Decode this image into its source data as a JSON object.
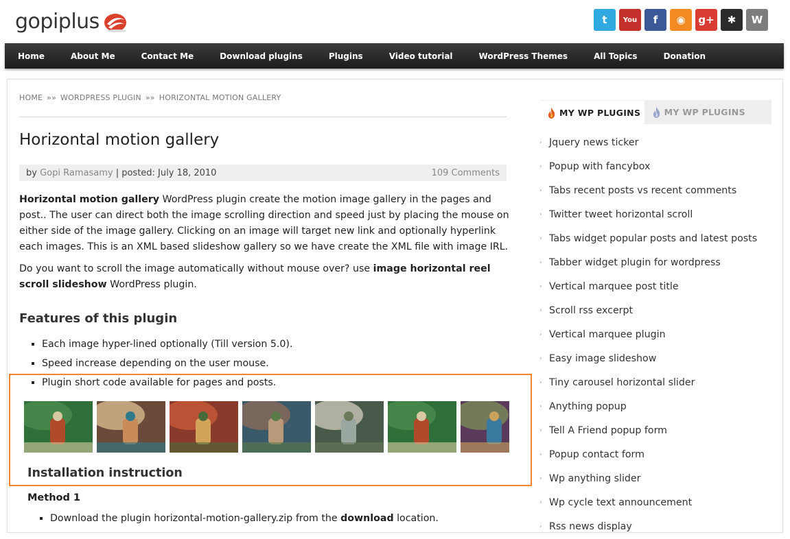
{
  "site": {
    "logo_text": "gopiplus"
  },
  "social": [
    {
      "icon": "twitter-icon",
      "glyph": "t",
      "color": "#2fa9e0"
    },
    {
      "icon": "youtube-icon",
      "glyph": "You",
      "color": "#c4302b"
    },
    {
      "icon": "facebook-icon",
      "glyph": "f",
      "color": "#3b5998"
    },
    {
      "icon": "rss-icon",
      "glyph": "◉",
      "color": "#f48a23"
    },
    {
      "icon": "google-plus-icon",
      "glyph": "g+",
      "color": "#d73d32"
    },
    {
      "icon": "joomla-icon",
      "glyph": "✱",
      "color": "#2b2b2b"
    },
    {
      "icon": "wordpress-icon",
      "glyph": "W",
      "color": "#7d7d7d"
    }
  ],
  "nav": [
    "Home",
    "About Me",
    "Contact Me",
    "Download plugins",
    "Plugins",
    "Video tutorial",
    "WordPress Themes",
    "All Topics",
    "Donation"
  ],
  "breadcrumb": {
    "home": "HOME",
    "sep": "»»",
    "section": "WORDPRESS PLUGIN",
    "current": "HORIZONTAL MOTION GALLERY"
  },
  "post": {
    "title": "Horizontal motion gallery",
    "by": "by",
    "author": "Gopi Ramasamy",
    "posted": "| posted: July 18, 2010",
    "comments": "109 Comments",
    "p1_bold": "Horizontal motion gallery",
    "p1_text": " WordPress plugin create the motion image gallery in the pages and post.. The user can direct both the image scrolling direction and speed just by placing the mouse on either side of the image gallery. Clicking on an image will target new link and optionally hyperlink each images. This is an XML based slideshow gallery so we have create the XML file with image IRL.",
    "p2_text": "Do you want to scroll the image automatically without mouse over? use ",
    "p2_bold": "image horizontal reel scroll slideshow",
    "p2_end": " WordPress plugin.",
    "features_heading": "Features of this plugin",
    "features": [
      "Each image hyper-lined optionally (Till version 5.0).",
      "Speed increase depending on the user mouse.",
      "Plugin short code available for pages and posts."
    ],
    "install_heading": "Installation instruction",
    "method_heading": "Method 1",
    "install_text": "Download the plugin horizontal-motion-gallery.zip from the ",
    "install_bold": "download",
    "install_end": " location."
  },
  "sidebar": {
    "tab_active": "MY WP PLUGINS",
    "tab_inactive": "MY WP PLUGINS",
    "items": [
      "Jquery news ticker",
      "Popup with fancybox",
      "Tabs recent posts vs recent comments",
      "Twitter tweet horizontal scroll",
      "Tabs widget popular posts and latest posts",
      "Tabber widget plugin for wordpress",
      "Vertical marquee post title",
      "Scroll rss excerpt",
      "Vertical marquee plugin",
      "Easy image slideshow",
      "Tiny carousel horizontal slider",
      "Anything popup",
      "Tell A Friend popup form",
      "Popup contact form",
      "Wp anything slider",
      "Wp cycle text announcement",
      "Rss news display"
    ]
  },
  "colors": {
    "accent_orange": "#f0852d",
    "nav_bg": "#2a2a2a",
    "link_gray": "#888888"
  }
}
